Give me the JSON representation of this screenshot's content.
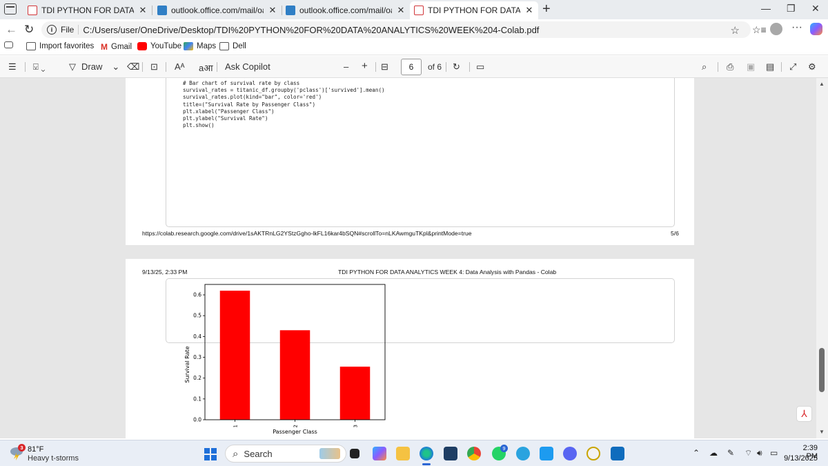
{
  "browser": {
    "tabs": [
      {
        "title": "TDI PYTHON FOR DATA ANALYTIC",
        "icon": "pdf-icon",
        "active": false
      },
      {
        "title": "outlook.office.com/mail/oauthRe",
        "icon": "outlook-icon",
        "active": false
      },
      {
        "title": "outlook.office.com/mail/oauthRe",
        "icon": "outlook-icon",
        "active": false
      },
      {
        "title": "TDI PYTHON FOR DATA ANALYTIC",
        "icon": "pdf-icon",
        "active": true
      }
    ],
    "address": {
      "scheme_label": "File",
      "url": "C:/Users/user/OneDrive/Desktop/TDI%20PYTHON%20FOR%20DATA%20ANALYTICS%20WEEK%204-Colab.pdf"
    },
    "favorites": [
      {
        "label": "Import favorites",
        "icon": "import-icon"
      },
      {
        "label": "Gmail",
        "icon": "gmail-icon"
      },
      {
        "label": "YouTube",
        "icon": "youtube-icon"
      },
      {
        "label": "Maps",
        "icon": "maps-icon"
      },
      {
        "label": "Dell",
        "icon": "folder-icon"
      }
    ]
  },
  "pdf_toolbar": {
    "draw_label": "Draw",
    "read_aloud_label": "Aᴬ",
    "translate_label": "aआ",
    "ask_copilot_label": "Ask Copilot",
    "zoom_out": "–",
    "zoom_in": "+",
    "current_page": "6",
    "page_total_label": "of 6"
  },
  "pdf": {
    "page5": {
      "code_lines": [
        "# Bar chart of survival rate by class",
        "survival_rates = titanic_df.groupby('pclass')['survived'].mean()",
        "survival_rates.plot(kind=\"bar\", color='red')",
        "title=(\"Survival Rate by Passenger Class\")",
        "plt.xlabel(\"Passenger Class\")",
        "plt.ylabel(\"Survival Rate\")",
        "plt.show()"
      ],
      "footer_url": "https://colab.research.google.com/drive/1sAKTRnLG2YStzGgho-lkFL16kar4bSQN#scrollTo=nLKAwmguTKpl&printMode=true",
      "footer_page": "5/6"
    },
    "page6": {
      "header_date": "9/13/25, 2:33 PM",
      "header_title": "TDI PYTHON FOR DATA ANALYTICS WEEK 4: Data Analysis with Pandas - Colab"
    }
  },
  "chart_data": {
    "type": "bar",
    "categories": [
      "1",
      "2",
      "3"
    ],
    "values": [
      0.62,
      0.43,
      0.255
    ],
    "xlabel": "Passenger Class",
    "ylabel": "Survival Rate",
    "ylim": [
      0,
      0.65
    ],
    "yticks": [
      "0.0",
      "0.1",
      "0.2",
      "0.3",
      "0.4",
      "0.5",
      "0.6"
    ],
    "bar_color": "#ff0000",
    "grid": false,
    "legend": "none"
  },
  "taskbar": {
    "weather_temp": "81°F",
    "weather_desc": "Heavy t-storms",
    "weather_badge": "3",
    "search_label": "Search",
    "whatsapp_badge": "9",
    "clock_time": "2:39 PM",
    "clock_date": "9/13/2025"
  }
}
